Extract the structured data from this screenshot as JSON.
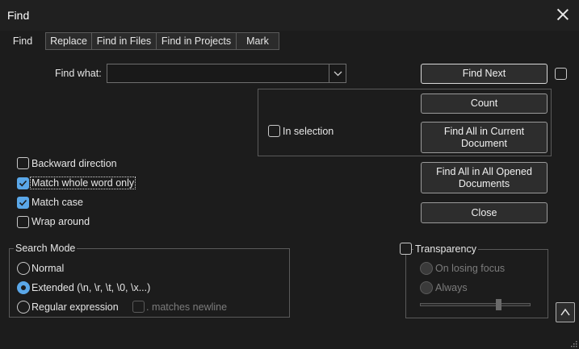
{
  "window": {
    "title": "Find"
  },
  "tabs": [
    {
      "label": "Find",
      "active": true
    },
    {
      "label": "Replace",
      "active": false
    },
    {
      "label": "Find in Files",
      "active": false
    },
    {
      "label": "Find in Projects",
      "active": false
    },
    {
      "label": "Mark",
      "active": false
    }
  ],
  "find_what": {
    "label": "Find what:",
    "value": "",
    "placeholder": ""
  },
  "buttons": {
    "find_next": "Find Next",
    "count": "Count",
    "find_all_current_1": "Find All in Current",
    "find_all_current_2": "Document",
    "find_all_opened_1": "Find All in All Opened",
    "find_all_opened_2": "Documents",
    "close": "Close"
  },
  "in_selection": {
    "label": "In selection",
    "checked": false
  },
  "options": {
    "backward": {
      "label": "Backward direction",
      "checked": false
    },
    "whole_word": {
      "label": "Match whole word only",
      "checked": true
    },
    "match_case": {
      "label": "Match case",
      "checked": true
    },
    "wrap": {
      "label": "Wrap around",
      "checked": false
    }
  },
  "search_mode": {
    "title": "Search Mode",
    "normal": "Normal",
    "extended": "Extended (\\n, \\r, \\t, \\0, \\x...)",
    "regex": "Regular expression",
    "matches_newline": ". matches newline",
    "selected": "extended"
  },
  "transparency": {
    "title": "Transparency",
    "enabled": false,
    "on_losing_focus": "On losing focus",
    "always": "Always",
    "level": 0.7
  },
  "colors": {
    "accent": "#5aa7e8",
    "background": "#1c1c1c",
    "titlebar": "#202020"
  },
  "icons": {
    "dropdown": "chevron-down-icon",
    "collapse": "chevron-up-icon",
    "close": "close-icon",
    "grip": "resize-grip-icon"
  }
}
